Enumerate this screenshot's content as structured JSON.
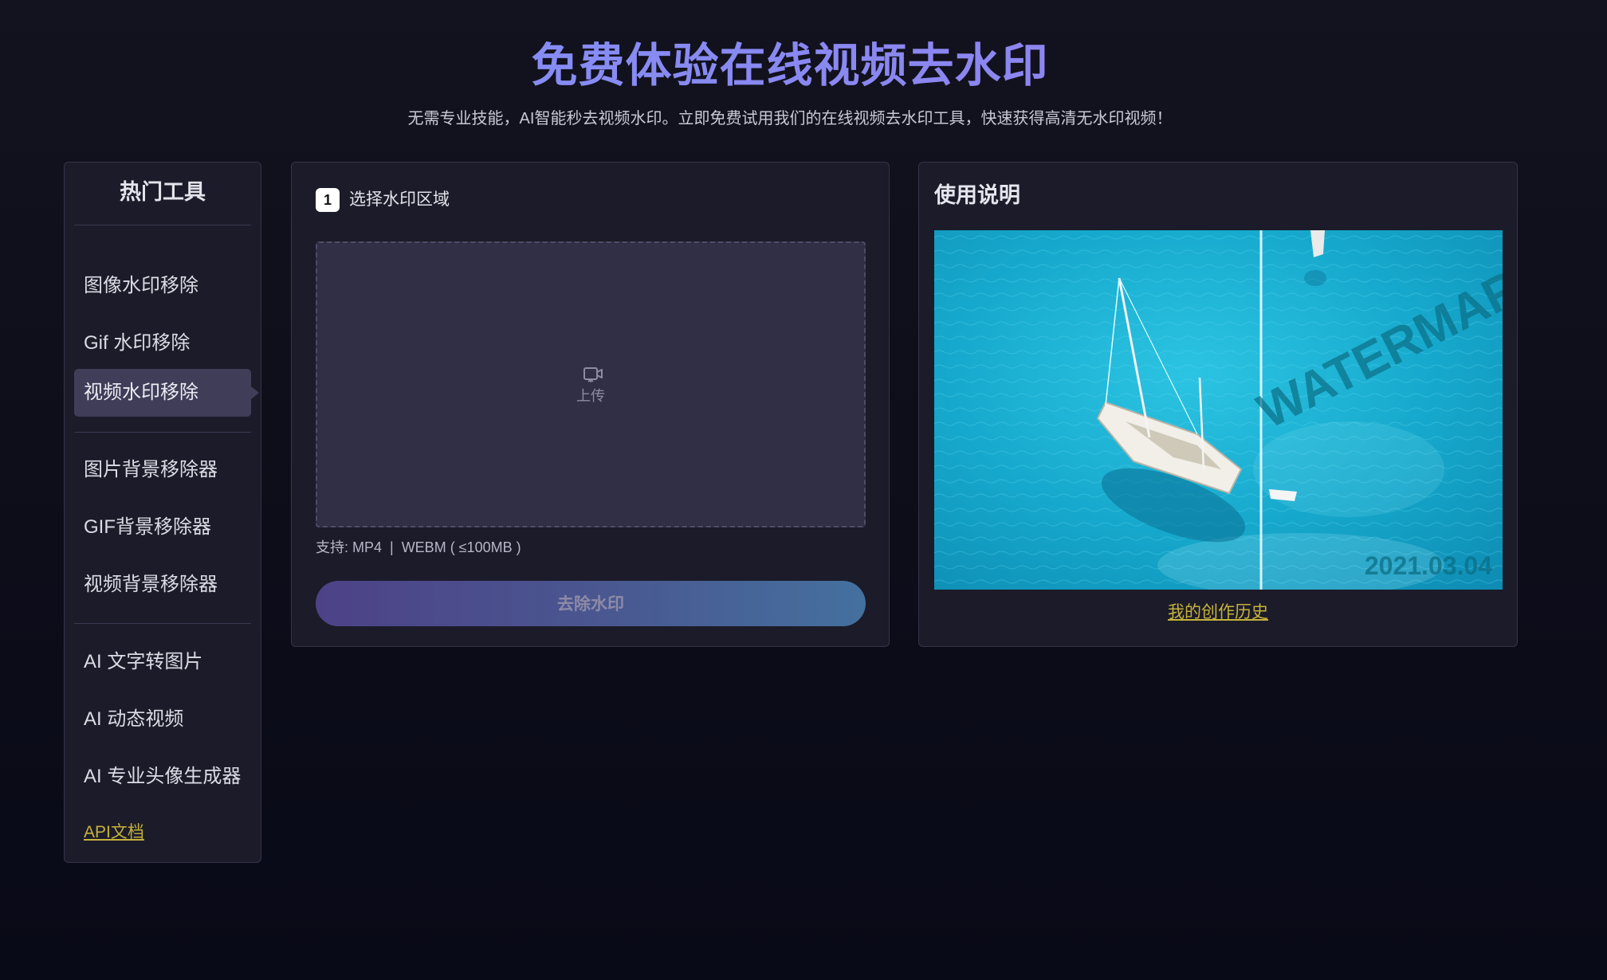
{
  "header": {
    "title": "免费体验在线视频去水印",
    "subtitle": "无需专业技能，AI智能秒去视频水印。立即免费试用我们的在线视频去水印工具，快速获得高清无水印视频！"
  },
  "sidebar": {
    "title": "热门工具",
    "groups": [
      {
        "items": [
          {
            "label": "图像水印移除",
            "active": false
          },
          {
            "label": "Gif 水印移除",
            "active": false
          },
          {
            "label": "视频水印移除",
            "active": true
          }
        ]
      },
      {
        "items": [
          {
            "label": "图片背景移除器",
            "active": false
          },
          {
            "label": "GIF背景移除器",
            "active": false
          },
          {
            "label": "视频背景移除器",
            "active": false
          }
        ]
      },
      {
        "items": [
          {
            "label": "AI 文字转图片",
            "active": false
          },
          {
            "label": "AI 动态视频",
            "active": false
          },
          {
            "label": "AI 专业头像生成器",
            "active": false
          }
        ]
      }
    ],
    "api_link": "API文档"
  },
  "upload": {
    "step_number": "1",
    "step_label": "选择水印区域",
    "icon": "video-upload-icon",
    "upload_label": "上传",
    "support_text": "支持: MP4  |  WEBM ( ≤100MB )",
    "button_label": "去除水印"
  },
  "instructions": {
    "title": "使用说明",
    "demo_watermark_text": "WATERMARK",
    "demo_date_text": "2021.03.04",
    "history_link": "我的创作历史"
  },
  "colors": {
    "background": "#0d0d1a",
    "panel": "#1c1b29",
    "title_gradient": "#7f95f8",
    "link": "#c4b23c",
    "active_item": "#3f3d57"
  }
}
